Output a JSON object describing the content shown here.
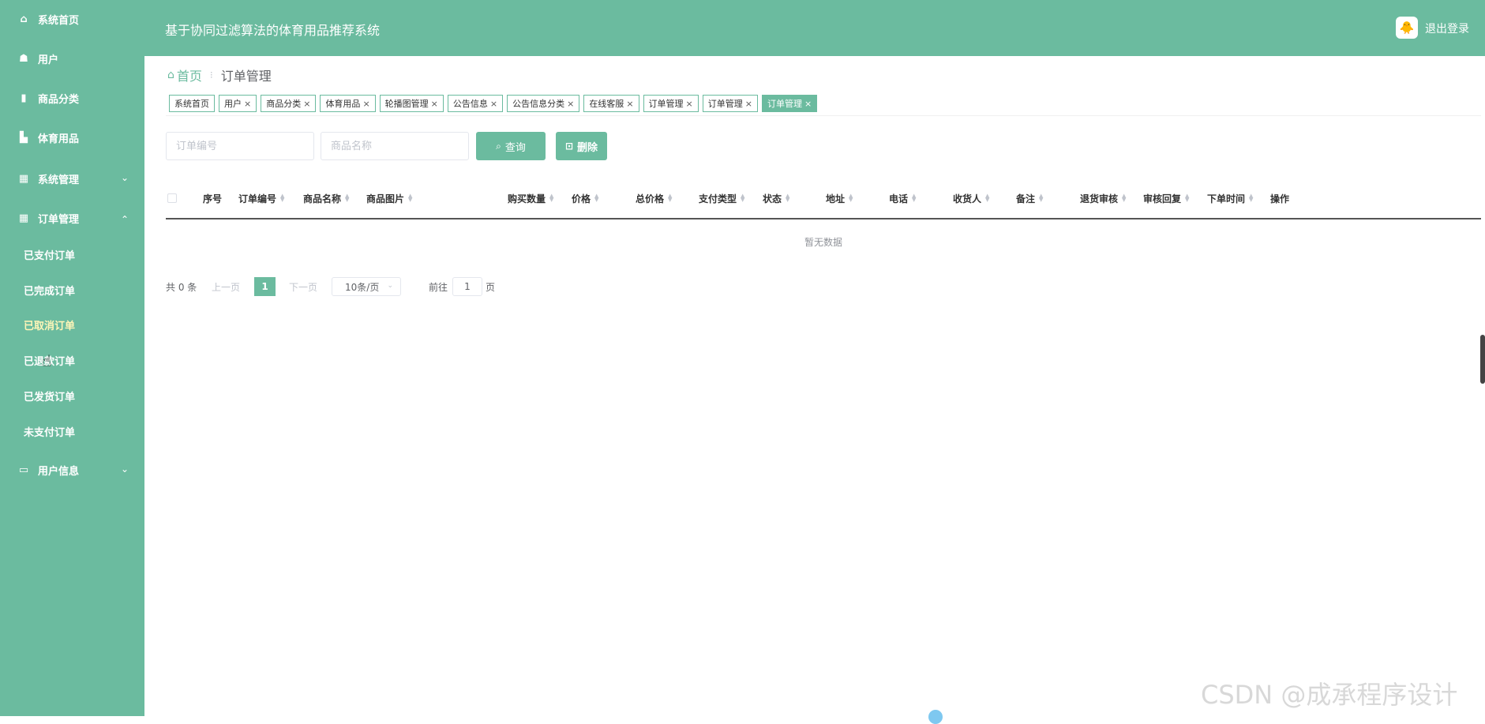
{
  "sidebar": {
    "items": [
      {
        "label": "系统首页",
        "icon": "home-icon"
      },
      {
        "label": "用户",
        "icon": "user-icon"
      },
      {
        "label": "商品分类",
        "icon": "book-icon"
      },
      {
        "label": "体育用品",
        "icon": "bar-chart-icon"
      },
      {
        "label": "系统管理",
        "icon": "grid-icon"
      },
      {
        "label": "订单管理",
        "icon": "grid-icon"
      },
      {
        "label": "用户信息",
        "icon": "card-icon"
      }
    ],
    "order_sub": [
      {
        "label": "已支付订单"
      },
      {
        "label": "已完成订单"
      },
      {
        "label": "已取消订单"
      },
      {
        "label": "已退款订单"
      },
      {
        "label": "已发货订单"
      },
      {
        "label": "未支付订单"
      }
    ]
  },
  "header": {
    "title": "基于协同过滤算法的体育用品推荐系统",
    "logout": "退出登录"
  },
  "breadcrumb": {
    "home": "首页",
    "current": "订单管理"
  },
  "tags": [
    {
      "label": "系统首页",
      "closable": false
    },
    {
      "label": "用户",
      "closable": true
    },
    {
      "label": "商品分类",
      "closable": true
    },
    {
      "label": "体育用品",
      "closable": true
    },
    {
      "label": "轮播图管理",
      "closable": true
    },
    {
      "label": "公告信息",
      "closable": true
    },
    {
      "label": "公告信息分类",
      "closable": true
    },
    {
      "label": "在线客服",
      "closable": true
    },
    {
      "label": "订单管理",
      "closable": true
    },
    {
      "label": "订单管理",
      "closable": true
    },
    {
      "label": "订单管理",
      "closable": true,
      "active": true
    }
  ],
  "search": {
    "order_no_placeholder": "订单编号",
    "product_name_placeholder": "商品名称",
    "query_label": "查询",
    "delete_label": "删除"
  },
  "table": {
    "columns": [
      {
        "label": "序号",
        "sortable": false
      },
      {
        "label": "订单编号",
        "sortable": true
      },
      {
        "label": "商品名称",
        "sortable": true
      },
      {
        "label": "商品图片",
        "sortable": true
      },
      {
        "label": "购买数量",
        "sortable": true
      },
      {
        "label": "价格",
        "sortable": true
      },
      {
        "label": "总价格",
        "sortable": true
      },
      {
        "label": "支付类型",
        "sortable": true
      },
      {
        "label": "状态",
        "sortable": true
      },
      {
        "label": "地址",
        "sortable": true
      },
      {
        "label": "电话",
        "sortable": true
      },
      {
        "label": "收货人",
        "sortable": true
      },
      {
        "label": "备注",
        "sortable": true
      },
      {
        "label": "退货审核",
        "sortable": true
      },
      {
        "label": "审核回复",
        "sortable": true
      },
      {
        "label": "下单时间",
        "sortable": true
      },
      {
        "label": "操作",
        "sortable": false
      }
    ],
    "empty_text": "暂无数据"
  },
  "pagination": {
    "total": "共 0 条",
    "prev": "上一页",
    "current_page": "1",
    "next": "下一页",
    "page_size": "10条/页",
    "goto_prefix": "前往",
    "goto_value": "1",
    "goto_suffix": "页"
  },
  "watermark": "CSDN @成承程序设计"
}
